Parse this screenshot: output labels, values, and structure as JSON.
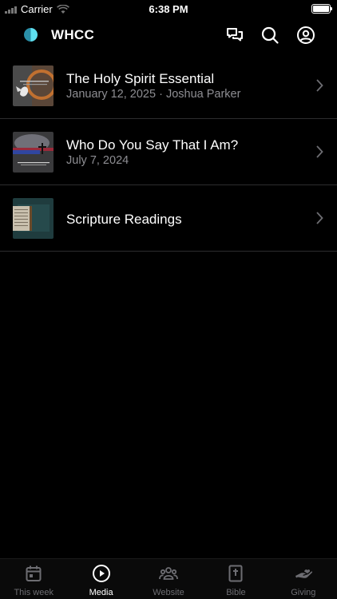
{
  "status_bar": {
    "carrier": "Carrier",
    "time": "6:38 PM"
  },
  "header": {
    "title": "WHCC"
  },
  "items": [
    {
      "title": "The Holy Spirit Essential",
      "subtitle": "January 12, 2025 · Joshua Parker",
      "thumb": "holy-spirit-thumbnail"
    },
    {
      "title": "Who Do You Say That I Am?",
      "subtitle": "July 7, 2024",
      "thumb": "sermon-series-thumbnail"
    },
    {
      "title": "Scripture Readings",
      "subtitle": "",
      "thumb": "bible-thumbnail"
    }
  ],
  "tabs": [
    {
      "label": "This week",
      "icon": "calendar-icon",
      "active": false
    },
    {
      "label": "Media",
      "icon": "play-circle-icon",
      "active": true
    },
    {
      "label": "Website",
      "icon": "people-icon",
      "active": false
    },
    {
      "label": "Bible",
      "icon": "bible-icon",
      "active": false
    },
    {
      "label": "Giving",
      "icon": "giving-hand-icon",
      "active": false
    }
  ],
  "colors": {
    "background": "#000000",
    "text": "#ffffff",
    "secondary_text": "#8e8e93",
    "inactive_tab": "#6d6d72",
    "logo_accent": "#5fe0f0"
  }
}
